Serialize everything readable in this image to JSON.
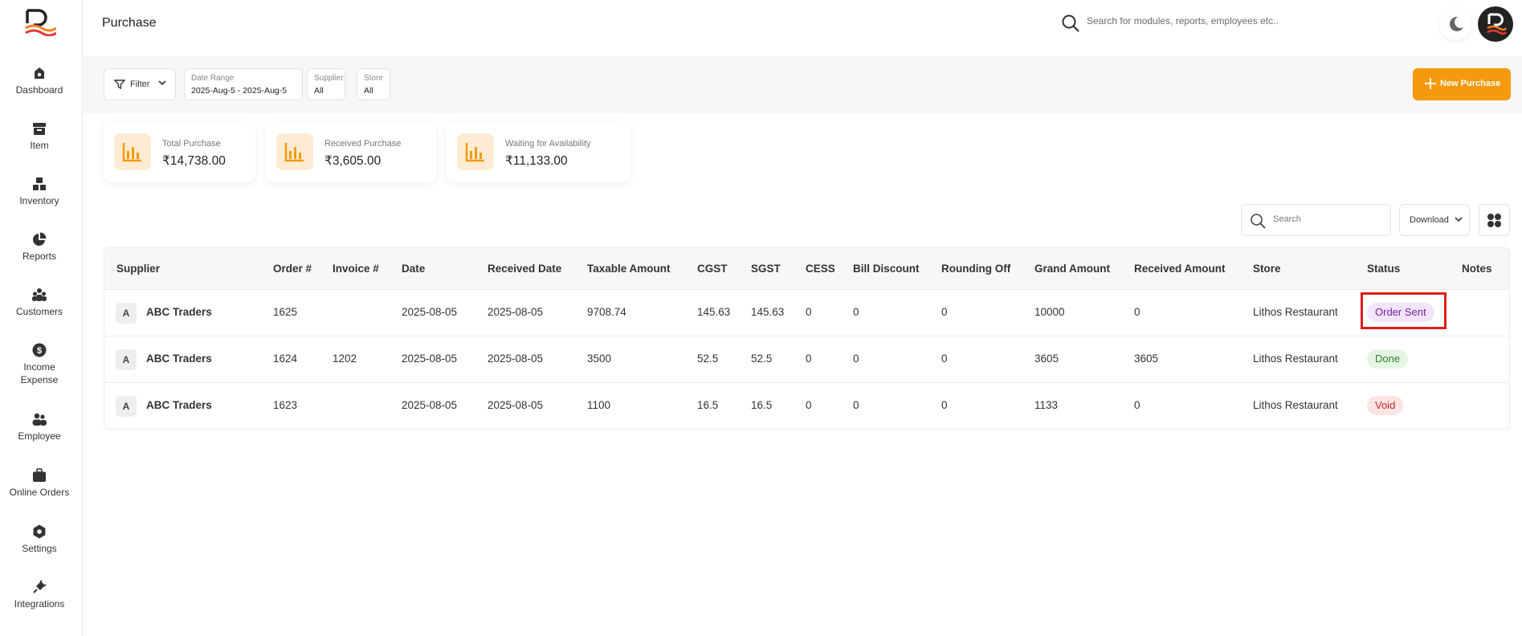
{
  "sidebar": {
    "items": [
      {
        "label": "Dashboard",
        "icon": "dashboard-icon"
      },
      {
        "label": "Item",
        "icon": "archive-box-icon"
      },
      {
        "label": "Inventory",
        "icon": "boxes-icon"
      },
      {
        "label": "Reports",
        "icon": "pie-chart-icon"
      },
      {
        "label": "Customers",
        "icon": "users-icon"
      },
      {
        "label": "Income\nExpense",
        "label_line1": "Income",
        "label_line2": "Expense",
        "icon": "dollar-icon"
      },
      {
        "label": "Employee",
        "icon": "employees-icon"
      },
      {
        "label": "Online Orders",
        "icon": "briefcase-icon"
      },
      {
        "label": "Settings",
        "icon": "gear-icon"
      },
      {
        "label": "Integrations",
        "icon": "plug-icon"
      }
    ]
  },
  "header": {
    "title": "Purchase",
    "search_placeholder": "Search for modules, reports, employees etc.."
  },
  "toolbar": {
    "filter_label": "Filter",
    "date_range_label": "Date Range",
    "date_range_value": "2025-Aug-5 - 2025-Aug-5",
    "supplier_label": "Supplier",
    "supplier_value": "All",
    "store_label": "Store",
    "store_value": "All",
    "new_purchase_label": "New Purchase"
  },
  "stats": [
    {
      "label": "Total Purchase",
      "value": "₹14,738.00"
    },
    {
      "label": "Received Purchase",
      "value": "₹3,605.00"
    },
    {
      "label": "Waiting for Availability",
      "value": "₹11,133.00"
    }
  ],
  "table_tools": {
    "search_placeholder": "Search",
    "download_label": "Download"
  },
  "table": {
    "columns": [
      "Supplier",
      "Order #",
      "Invoice #",
      "Date",
      "Received Date",
      "Taxable Amount",
      "CGST",
      "SGST",
      "CESS",
      "Bill Discount",
      "Rounding Off",
      "Grand Amount",
      "Received Amount",
      "Store",
      "Status",
      "Notes"
    ],
    "rows": [
      {
        "avatar": "A",
        "supplier": "ABC Traders",
        "order": "1625",
        "invoice": "",
        "date": "2025-08-05",
        "received_date": "2025-08-05",
        "taxable": "9708.74",
        "cgst": "145.63",
        "sgst": "145.63",
        "cess": "0",
        "bill_discount": "0",
        "rounding": "0",
        "grand": "10000",
        "received": "0",
        "store": "Lithos Restaurant",
        "status": "Order Sent",
        "notes": ""
      },
      {
        "avatar": "A",
        "supplier": "ABC Traders",
        "order": "1624",
        "invoice": "1202",
        "date": "2025-08-05",
        "received_date": "2025-08-05",
        "taxable": "3500",
        "cgst": "52.5",
        "sgst": "52.5",
        "cess": "0",
        "bill_discount": "0",
        "rounding": "0",
        "grand": "3605",
        "received": "3605",
        "store": "Lithos Restaurant",
        "status": "Done",
        "notes": ""
      },
      {
        "avatar": "A",
        "supplier": "ABC Traders",
        "order": "1623",
        "invoice": "",
        "date": "2025-08-05",
        "received_date": "2025-08-05",
        "taxable": "1100",
        "cgst": "16.5",
        "sgst": "16.5",
        "cess": "0",
        "bill_discount": "0",
        "rounding": "0",
        "grand": "1133",
        "received": "0",
        "store": "Lithos Restaurant",
        "status": "Void",
        "notes": ""
      }
    ]
  },
  "colors": {
    "accent": "#f59a0c",
    "status_order_sent_bg": "#f1e4fb",
    "status_order_sent_fg": "#7b1fa2",
    "status_done_bg": "#e6f5e3",
    "status_done_fg": "#2e7d32",
    "status_void_bg": "#fde4e4",
    "status_void_fg": "#c62828",
    "highlight": "#e11d1d"
  }
}
